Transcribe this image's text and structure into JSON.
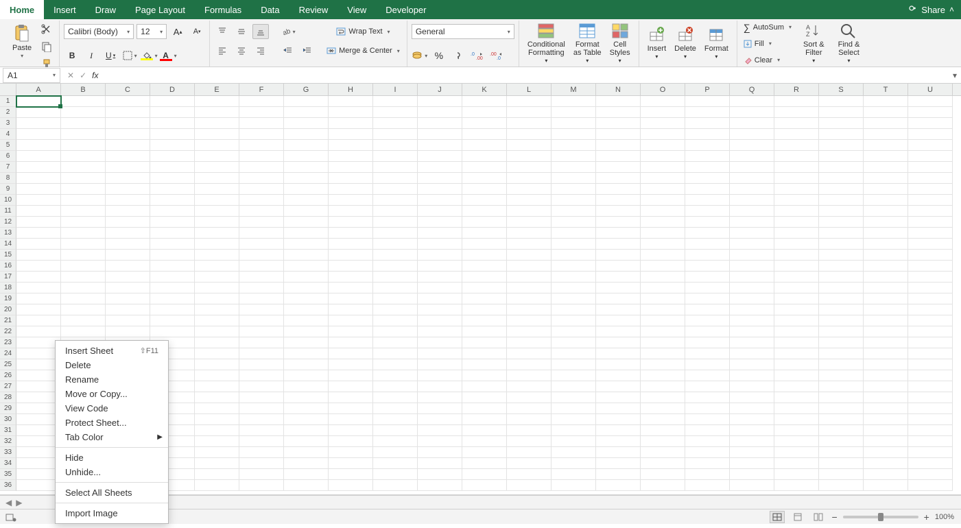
{
  "tabs": [
    "Home",
    "Insert",
    "Draw",
    "Page Layout",
    "Formulas",
    "Data",
    "Review",
    "View",
    "Developer"
  ],
  "active_tab": "Home",
  "share_label": "Share",
  "clipboard": {
    "paste": "Paste"
  },
  "font": {
    "name": "Calibri (Body)",
    "size": "12",
    "bold": "B",
    "italic": "I",
    "underline": "U"
  },
  "alignment": {
    "wrap": "Wrap Text",
    "merge": "Merge & Center"
  },
  "number": {
    "format": "General",
    "percent": "%"
  },
  "styles": {
    "conditional": "Conditional\nFormatting",
    "format_table": "Format\nas Table",
    "cell_styles": "Cell\nStyles"
  },
  "cells": {
    "insert": "Insert",
    "delete": "Delete",
    "format": "Format"
  },
  "editing": {
    "autosum": "AutoSum",
    "fill": "Fill",
    "clear": "Clear",
    "sort": "Sort &\nFilter",
    "find": "Find &\nSelect"
  },
  "namebox": "A1",
  "columns": [
    "A",
    "B",
    "C",
    "D",
    "E",
    "F",
    "G",
    "H",
    "I",
    "J",
    "K",
    "L",
    "M",
    "N",
    "O",
    "P",
    "Q",
    "R",
    "S",
    "T",
    "U"
  ],
  "row_count": 36,
  "selected_cell": "A1",
  "context_menu": {
    "items": [
      {
        "label": "Insert Sheet",
        "shortcut": "⇧F11"
      },
      {
        "label": "Delete"
      },
      {
        "label": "Rename"
      },
      {
        "label": "Move or Copy..."
      },
      {
        "label": "View Code"
      },
      {
        "label": "Protect Sheet..."
      },
      {
        "label": "Tab Color",
        "submenu": true
      },
      {
        "sep": true
      },
      {
        "label": "Hide"
      },
      {
        "label": "Unhide..."
      },
      {
        "sep": true
      },
      {
        "label": "Select All Sheets"
      },
      {
        "sep": true
      },
      {
        "label": "Import Image"
      }
    ]
  },
  "zoom": "100%"
}
